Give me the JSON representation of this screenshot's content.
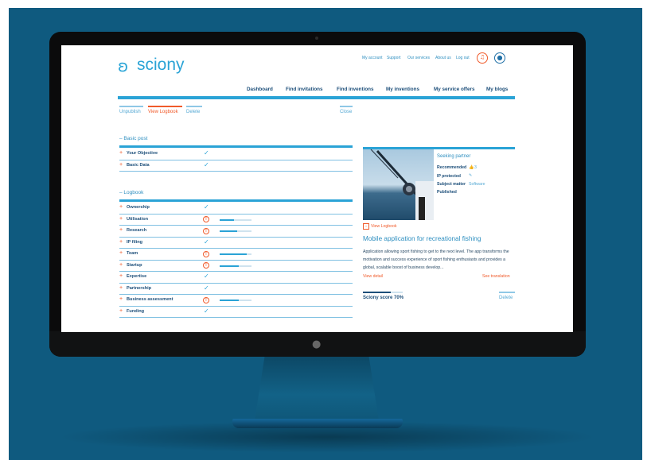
{
  "brand": {
    "name": "sciony"
  },
  "top_links": [
    "My account",
    "Support",
    "Our services",
    "About us",
    "Log out"
  ],
  "nav": [
    "Dashboard",
    "Find invitations",
    "Find inventions",
    "My inventions",
    "My service offers",
    "My blogs"
  ],
  "actions": {
    "unpublish": "Unpublish",
    "view_logbook": "View Logbook",
    "delete": "Delete",
    "close": "Close"
  },
  "basic_post": {
    "title": "Basic post",
    "items": [
      {
        "label": "Your Objective",
        "status": "done"
      },
      {
        "label": "Basic Data",
        "status": "done"
      }
    ]
  },
  "logbook": {
    "title": "Logbook",
    "items": [
      {
        "label": "Ownership",
        "status": "done",
        "progress": null
      },
      {
        "label": "Utilisation",
        "status": "warning",
        "progress": 0.45
      },
      {
        "label": "Research",
        "status": "warning",
        "progress": 0.55
      },
      {
        "label": "IP filing",
        "status": "done",
        "progress": null
      },
      {
        "label": "Team",
        "status": "warning",
        "progress": 0.85
      },
      {
        "label": "Startup",
        "status": "warning",
        "progress": 0.6
      },
      {
        "label": "Expertise",
        "status": "done",
        "progress": null
      },
      {
        "label": "Partnership",
        "status": "done",
        "progress": null
      },
      {
        "label": "Business assessment",
        "status": "warning",
        "progress": 0.6
      },
      {
        "label": "Funding",
        "status": "done",
        "progress": null
      }
    ]
  },
  "card": {
    "seeking": "Seeking partner",
    "recommended_label": "Recommended",
    "recommended_value": "3",
    "ip_label": "IP protected",
    "subject_label": "Subject matter",
    "subject_value": "Software",
    "published_label": "Published",
    "view_logbook": "View Logbook",
    "title": "Mobile application for recreational fishing",
    "description": "Application allowing sport fishing to get to the next level. The app transforms the motivation and success experience of sport fishing enthusiasts and provides a global, scalable boost of business develop...",
    "view_detail": "View detail",
    "see_translation": "See translation",
    "score_label": "Sciony score 70%",
    "score": 0.7,
    "delete": "Delete"
  },
  "icons": {
    "check": "check-icon",
    "warning": "alert-circle-icon",
    "bell": "bell-icon",
    "user": "user-icon",
    "apple": "apple-logo-icon"
  },
  "colors": {
    "accent": "#2aa3d6",
    "alert": "#f05a2a",
    "background": "#0f5a7f",
    "text_dark": "#1d4f7a"
  }
}
